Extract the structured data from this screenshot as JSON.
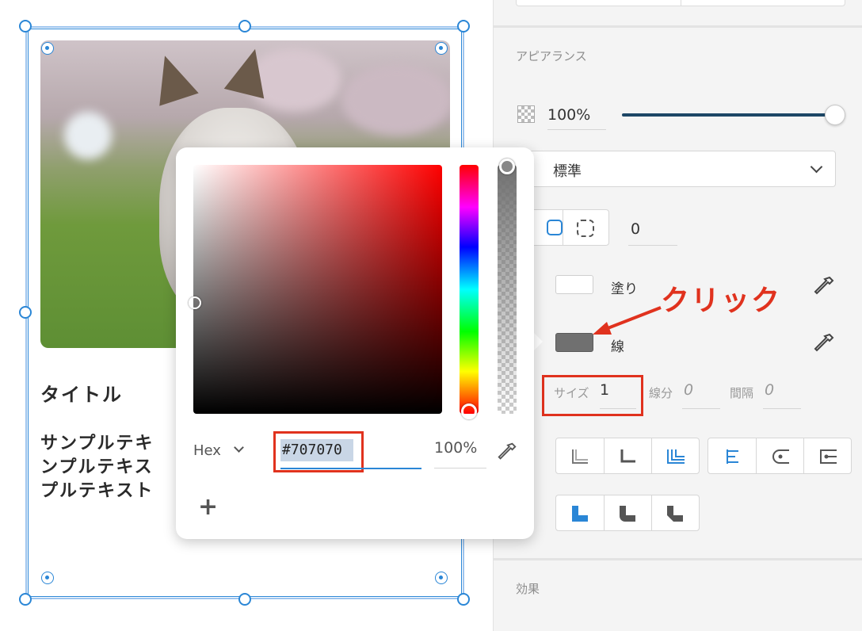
{
  "canvas": {
    "card": {
      "title": "タイトル",
      "body_lines": [
        "サンプルテキ",
        "ンプルテキス",
        "プルテキスト"
      ]
    }
  },
  "panel": {
    "appearance": {
      "heading": "アピアランス",
      "opacity": "100%",
      "blend_mode": "標準",
      "corner_radius": "0"
    },
    "fill": {
      "label": "塗り",
      "color": "#ffffff"
    },
    "stroke": {
      "label": "線",
      "color": "#707070",
      "size_label": "サイズ",
      "size_value": "1",
      "dash_label": "線分",
      "dash_value": "0",
      "gap_label": "間隔",
      "gap_value": "0"
    },
    "effects": {
      "heading": "効果"
    }
  },
  "color_picker": {
    "mode": "Hex",
    "hex_value": "#707070",
    "opacity": "100%",
    "add_label": "+"
  },
  "annotation": {
    "text": "クリック",
    "color": "#e0321e"
  },
  "colors": {
    "accent": "#2a86d6",
    "slider": "#1d4766",
    "highlight": "#e0321e"
  }
}
